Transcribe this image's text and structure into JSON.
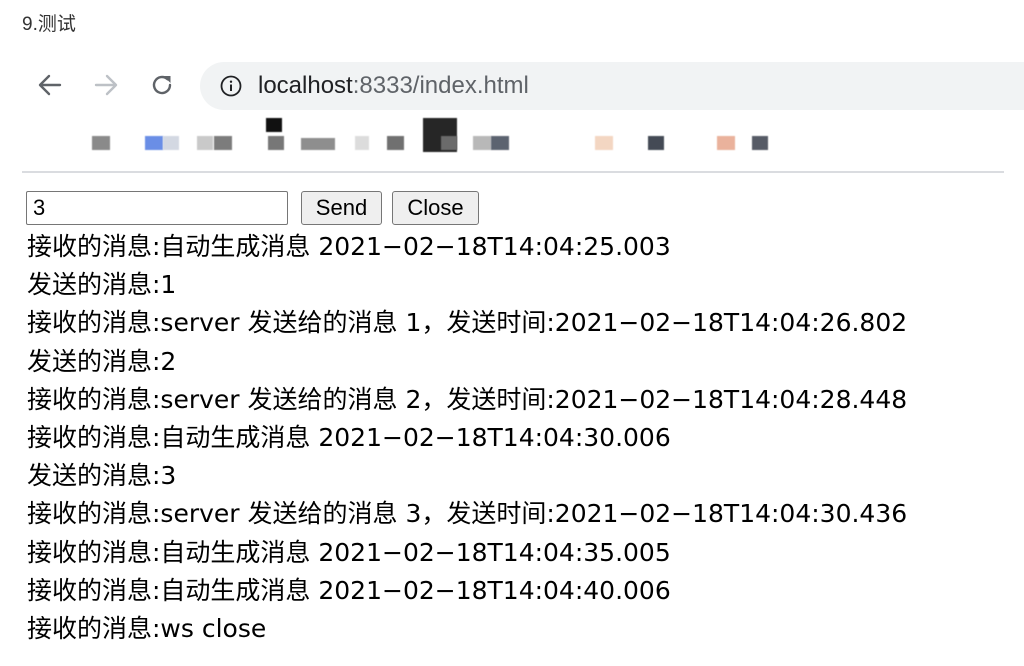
{
  "heading": "9.测试",
  "browser": {
    "url_host": "localhost",
    "url_rest": ":8333/index.html"
  },
  "input": {
    "value": "3"
  },
  "buttons": {
    "send": "Send",
    "close": "Close"
  },
  "log": [
    "接收的消息:自动生成消息 2021−02−18T14:04:25.003",
    "发送的消息:1",
    "接收的消息:server 发送给的消息 1，发送时间:2021−02−18T14:04:26.802",
    "发送的消息:2",
    "接收的消息:server 发送给的消息 2，发送时间:2021−02−18T14:04:28.448",
    "接收的消息:自动生成消息 2021−02−18T14:04:30.006",
    "发送的消息:3",
    "接收的消息:server 发送给的消息 3，发送时间:2021−02−18T14:04:30.436",
    "接收的消息:自动生成消息 2021−02−18T14:04:35.005",
    "接收的消息:自动生成消息 2021−02−18T14:04:40.006",
    "接收的消息:ws close"
  ]
}
